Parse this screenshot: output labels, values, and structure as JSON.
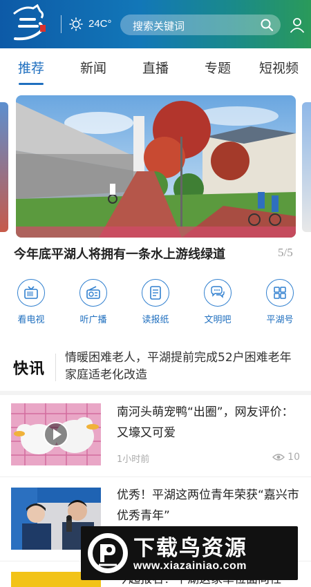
{
  "header": {
    "temperature": "24C°",
    "search_placeholder": "搜索关键词"
  },
  "tabs": [
    "推荐",
    "新闻",
    "直播",
    "专题",
    "短视频"
  ],
  "active_tab": 0,
  "carousel": {
    "caption": "今年底平湖人将拥有一条水上游线绿道",
    "counter": "5/5"
  },
  "quick_nav": [
    {
      "label": "看电视",
      "icon": "tv-icon"
    },
    {
      "label": "听广播",
      "icon": "radio-icon"
    },
    {
      "label": "读报纸",
      "icon": "newspaper-icon"
    },
    {
      "label": "文明吧",
      "icon": "chat-bubbles-icon"
    },
    {
      "label": "平湖号",
      "icon": "grid-apps-icon"
    }
  ],
  "flash": {
    "logo_text": "快讯",
    "text": "情暖困难老人，平湖提前完成52户困难老年家庭适老化改造"
  },
  "news": [
    {
      "title": "南河头萌宠鸭“出圈”，网友评价：又壕又可爱",
      "time": "1小时前",
      "views": "10",
      "has_video": true
    },
    {
      "title": "优秀！平湖这两位青年荣获“嘉兴市优秀青年”"
    },
    {
      "title": "今起报名！平湖这家单位面向社"
    }
  ],
  "watermark": {
    "title": "下载鸟资源",
    "url": "www.xiazainiao.com"
  },
  "colors": {
    "accent": "#1f6fbf",
    "header_start": "#0d5aa7",
    "header_end": "#2a9a5a"
  }
}
